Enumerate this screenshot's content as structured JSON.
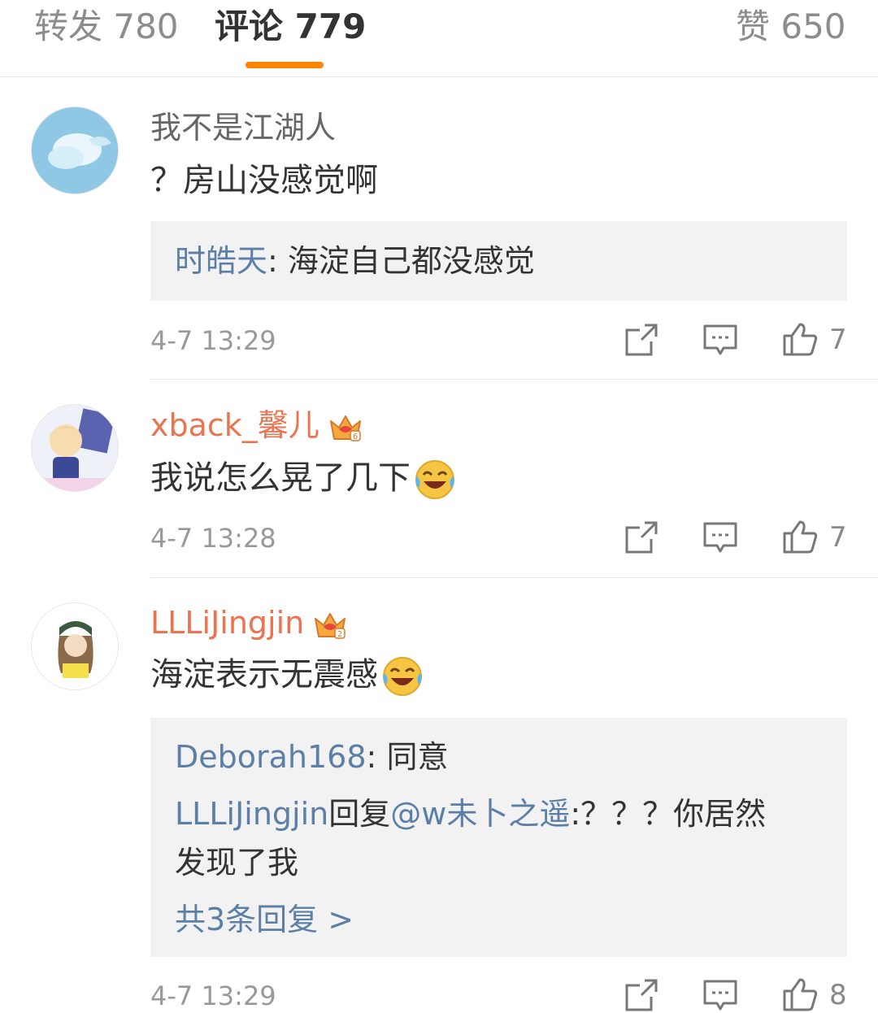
{
  "tabs": {
    "repost": "转发 780",
    "comments": "评论 779",
    "likes": "赞 650"
  },
  "colors": {
    "accent": "#ff8200",
    "link": "#5c7fa8",
    "vip_name": "#eb7350"
  },
  "comments": [
    {
      "username": "我不是江湖人",
      "text": "？房山没感觉啊",
      "replies": [
        {
          "author": "时皓天",
          "sep": ": ",
          "text": "海淀自己都没感觉"
        }
      ],
      "time": "4-7 13:29",
      "likes": "7"
    },
    {
      "username": "xback_馨儿",
      "text": "我说怎么晃了几下",
      "time": "4-7 13:28",
      "likes": "7"
    },
    {
      "username": "LLLiJingjin",
      "text": "海淀表示无震感",
      "replies": [
        {
          "author": "Deborah168",
          "sep": ": ",
          "text": "同意"
        },
        {
          "author": "LLLiJingjin",
          "mid": "回复",
          "mention": "@w未卜之遥",
          "text": ":？？？你居然",
          "text2": "发现了我"
        }
      ],
      "more_replies": "共3条回复 >",
      "time": "4-7 13:29",
      "likes": "8"
    }
  ]
}
